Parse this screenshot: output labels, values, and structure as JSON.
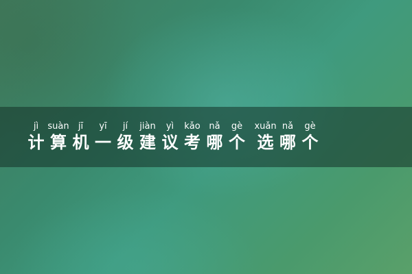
{
  "title": {
    "characters": [
      {
        "hanzi": "计",
        "pinyin": "jì"
      },
      {
        "hanzi": "算",
        "pinyin": "suàn"
      },
      {
        "hanzi": "机",
        "pinyin": "jī"
      },
      {
        "hanzi": "一",
        "pinyin": "yī"
      },
      {
        "hanzi": "级",
        "pinyin": "jí"
      },
      {
        "hanzi": "建",
        "pinyin": "jiàn"
      },
      {
        "hanzi": "议",
        "pinyin": "yì"
      },
      {
        "hanzi": "考",
        "pinyin": "kǎo"
      },
      {
        "hanzi": "哪",
        "pinyin": "nǎ"
      },
      {
        "hanzi": "个",
        "pinyin": "gè"
      },
      {
        "hanzi": "选",
        "pinyin": "xuǎn"
      },
      {
        "hanzi": "哪",
        "pinyin": "nǎ"
      },
      {
        "hanzi": "个",
        "pinyin": "gè"
      }
    ]
  },
  "colors": {
    "background_main": "#3a8a6e",
    "band": "#14322b",
    "text": "#ffffff"
  }
}
